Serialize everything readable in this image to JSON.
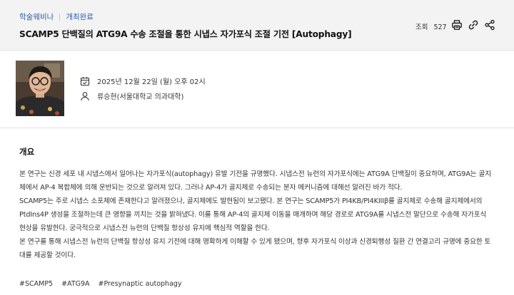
{
  "header": {
    "category": "학술웨비나",
    "status": "개최완료",
    "title": "SCAMP5 단백질의 ATG9A 수송 조절을 통한 시냅스 자가포식 조절 기전 [Autophagy]",
    "views_label": "조회",
    "views_count": "527",
    "icons": [
      "print-icon",
      "link-icon",
      "share-icon"
    ]
  },
  "profile": {
    "datetime": "2025년 12월 22일 (월) 오후 02시",
    "speaker": "류승현(서울대학교 의과대학)",
    "icons": [
      "calendar-icon",
      "person-icon"
    ]
  },
  "content": {
    "heading": "개요",
    "lines": [
      "본 연구는 신경 세포 내 시냅스에서 일어나는 자가포식(autophagy) 유발 기전을 규명했다. 시냅스전 뉴런의 자가포식에는 ATG9A 단백질이 중요하며, ATG9A는 골지",
      "체에서 AP-4 복합체에 의해 운반되는 것으로 알려져 있다. 그러나 AP-4가 골지체로 수송되는 분자 메커니즘에 대해선 알려진 바가 적다.",
      "SCAMP5는 주로 시냅스 소포체에 존재한다고 알려졌으나, 골지체에도 발현됨이 보고됐다. 본 연구는 SCAMP5가 PI4KB/PI4KIIIβ를 골지체로 수송해 골지체에서의",
      "PtdIns4P 생성을 조절하는데 큰 영향을 끼치는 것을 밝혀냈다. 이를 통해 AP-4의 골지체 이동을 매개하며 해당 경로로 ATG9A를 시냅스전 말단으로 수송해 자가포식",
      "현상을 유발한다. 궁극적으로 시냅스전 뉴런의 단백질 항상성 유지에 핵심적 역할을 한다.",
      "본 연구를 통해 시냅스전 뉴런의 단백질 항상성 유지 기전에 대해 명확하게 이해할 수 있게 됐으며, 향후 자가포식 이상과 신경퇴행성 질환 간 연결고리 규명에 중요한 토",
      "대를 제공할 것이다."
    ]
  },
  "tags": [
    "#SCAMP5",
    "#ATG9A",
    "#Presynaptic autophagy"
  ],
  "colors": {
    "accent": "#2f62ad",
    "header_bg": "#f3f3f4",
    "text": "#333333"
  }
}
